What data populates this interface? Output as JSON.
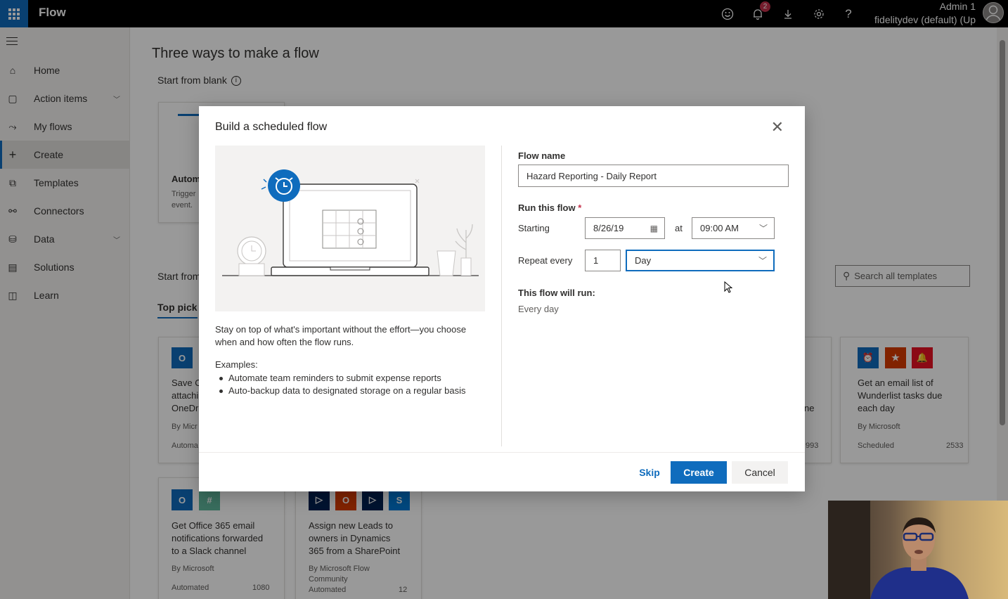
{
  "topbar": {
    "app_name": "Flow",
    "notification_count": "2",
    "user_name": "Admin 1",
    "environment": "fidelitydev (default) (Up",
    "icons": [
      "smiley-icon",
      "bell-icon",
      "download-icon",
      "gear-icon",
      "help-icon",
      "avatar-icon"
    ]
  },
  "sidebar": {
    "items": [
      {
        "label": "Home",
        "icon": "home-icon"
      },
      {
        "label": "Action items",
        "icon": "clipboard-icon",
        "expandable": true
      },
      {
        "label": "My flows",
        "icon": "flow-icon"
      },
      {
        "label": "Create",
        "icon": "plus-icon",
        "active": true
      },
      {
        "label": "Templates",
        "icon": "templates-icon"
      },
      {
        "label": "Connectors",
        "icon": "connector-icon"
      },
      {
        "label": "Data",
        "icon": "database-icon",
        "expandable": true
      },
      {
        "label": "Solutions",
        "icon": "solutions-icon"
      },
      {
        "label": "Learn",
        "icon": "book-icon"
      }
    ]
  },
  "main": {
    "page_title": "Three ways to make a flow",
    "start_blank": "Start from blank",
    "blank_card_title": "Autom",
    "blank_card_desc_1": "Trigger",
    "blank_card_desc_2": "event.",
    "start_template": "Start from",
    "tab_top_picks": "Top pick",
    "search_placeholder": "Search all templates",
    "cards": [
      {
        "title_lines": [
          "Save O",
          "attachi",
          "OneDr"
        ],
        "by": "By Micr",
        "type": "Automa",
        "count": ""
      },
      {
        "title_lines": [
          "Get an email list of",
          "Wunderlist tasks due",
          "each day"
        ],
        "by": "By Microsoft",
        "type": "Scheduled",
        "count": "2533"
      },
      {
        "title_lines": [
          "Get Office 365 email",
          "notifications forwarded",
          "to a Slack channel"
        ],
        "by": "By Microsoft",
        "type": "Automated",
        "count": "1080"
      },
      {
        "title_lines": [
          "Assign new Leads to",
          "owners in Dynamics",
          "365 from a SharePoint"
        ],
        "by_lines": [
          "By Microsoft Flow",
          "Community"
        ],
        "type": "Automated",
        "count": "12"
      }
    ],
    "partial_count": "993",
    "partial_text": "ne"
  },
  "dialog": {
    "title": "Build a scheduled flow",
    "description": "Stay on top of what's important without the effort—you choose when and how often the flow runs.",
    "examples_label": "Examples:",
    "examples": [
      "Automate team reminders to submit expense reports",
      "Auto-backup data to designated storage on a regular basis"
    ],
    "flow_name_label": "Flow name",
    "flow_name_value": "Hazard Reporting - Daily Report",
    "run_label": "Run this flow",
    "required_mark": "*",
    "starting_label": "Starting",
    "start_date": "8/26/19",
    "at_label": "at",
    "start_time": "09:00 AM",
    "repeat_label": "Repeat every",
    "repeat_interval": "1",
    "repeat_unit": "Day",
    "will_run_label": "This flow will run:",
    "will_run_value": "Every day",
    "skip_label": "Skip",
    "create_label": "Create",
    "cancel_label": "Cancel"
  },
  "colors": {
    "brand": "#0f6cbd",
    "topbar": "#000000",
    "sidebar": "#f3f2f1",
    "overlay": "rgba(0,0,0,0.4)"
  }
}
